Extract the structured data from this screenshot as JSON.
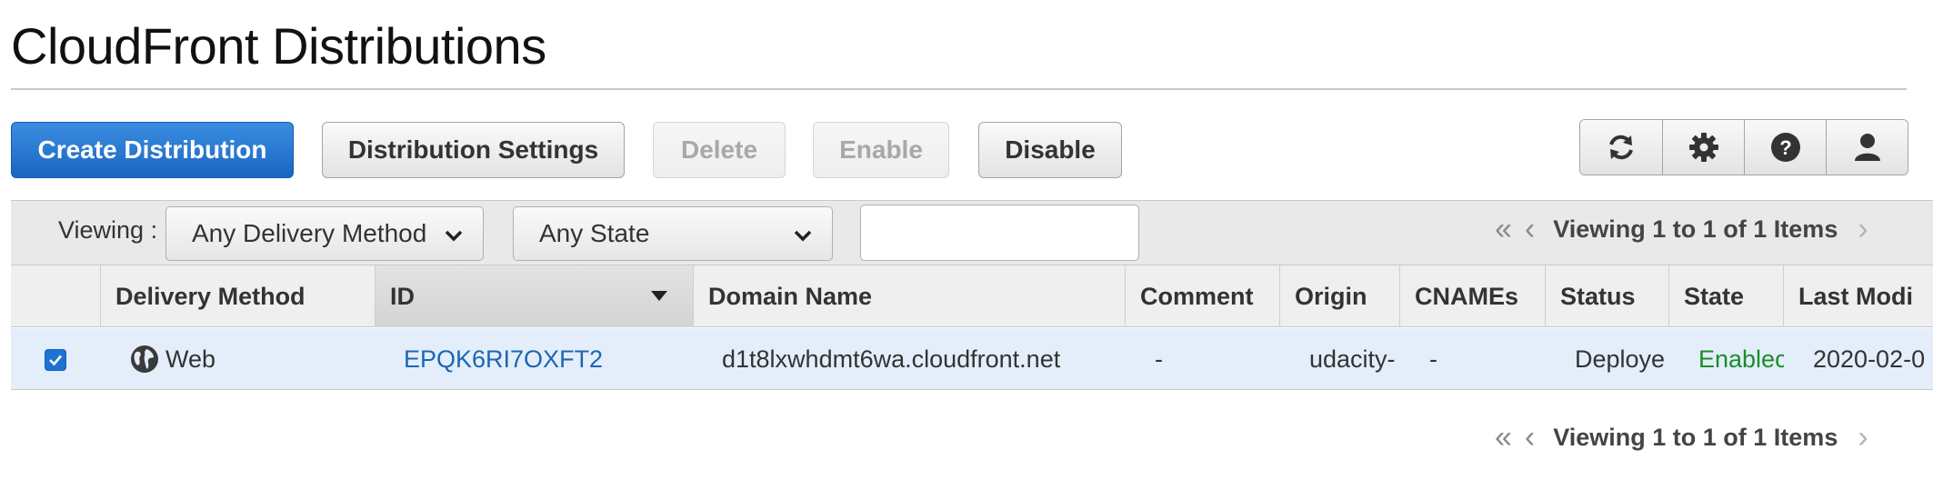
{
  "page": {
    "title": "CloudFront Distributions"
  },
  "toolbar": {
    "create_label": "Create Distribution",
    "settings_label": "Distribution Settings",
    "delete_label": "Delete",
    "enable_label": "Enable",
    "disable_label": "Disable",
    "icons": [
      "refresh-icon",
      "gear-icon",
      "help-icon",
      "user-icon"
    ]
  },
  "filters": {
    "viewing_label": "Viewing :",
    "delivery_method": "Any Delivery Method",
    "state": "Any State",
    "search_value": ""
  },
  "pagination": {
    "top": "Viewing 1 to 1 of 1 Items",
    "bottom": "Viewing 1 to 1 of 1 Items"
  },
  "table": {
    "columns": [
      "Delivery Method",
      "ID",
      "Domain Name",
      "Comment",
      "Origin",
      "CNAMEs",
      "Status",
      "State",
      "Last Modi"
    ],
    "sorted_column": "ID",
    "rows": [
      {
        "selected": true,
        "delivery_method": "Web",
        "id": "EPQK6RI7OXFT2",
        "domain_name": "d1t8lxwhdmt6wa.cloudfront.net",
        "comment": "-",
        "origin": "udacity-",
        "cnames": "-",
        "status": "Deploye",
        "state": "Enablec",
        "last_modified": "2020-02-0"
      }
    ]
  },
  "colors": {
    "primary_button": "#1a66c3",
    "link": "#1d65b3",
    "enabled_state": "#1c8c2a",
    "selected_row": "#e3eefa"
  }
}
